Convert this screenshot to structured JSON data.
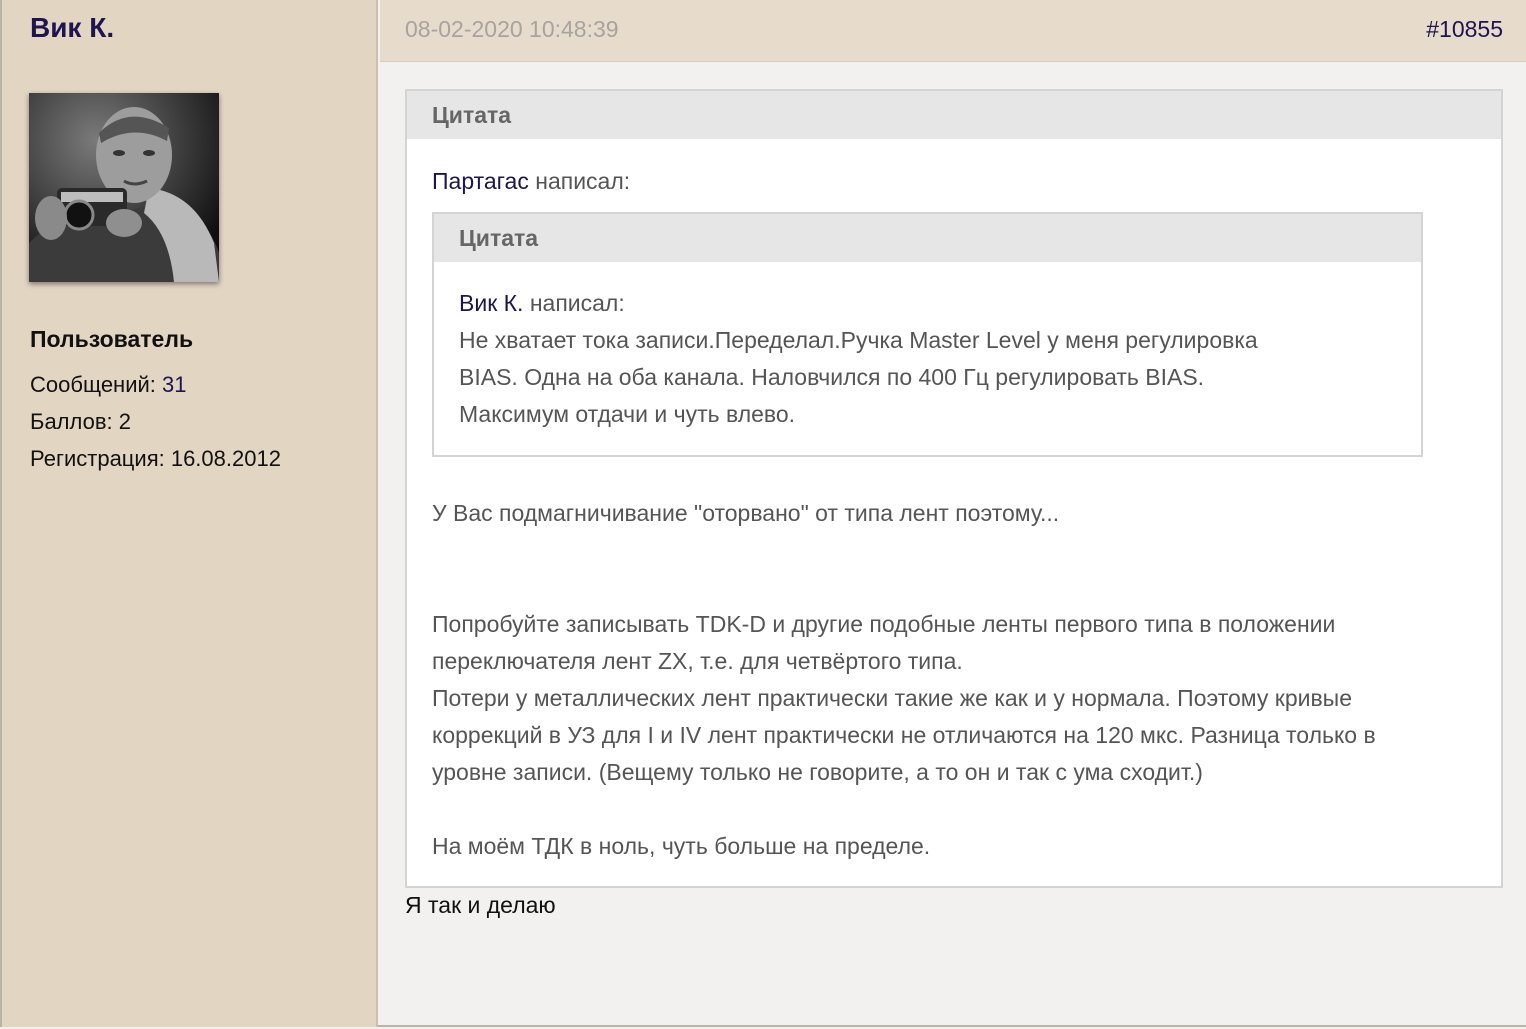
{
  "user": {
    "name": "Вик К.",
    "rank": "Пользователь",
    "messages_label": "Сообщений: ",
    "messages_value": "31",
    "points_label": "Баллов: 2",
    "registration_label": "Регистрация: 16.08.2012"
  },
  "post": {
    "date": "08-02-2020 10:48:39",
    "number": "#10855",
    "reply_text": "Я так и делаю"
  },
  "outer_quote": {
    "title": "Цитата",
    "author": "Партагас",
    "wrote": " написал:",
    "lines": [
      "У Вас подмагничивание \"оторвано\" от типа лент поэтому...",
      "Попробуйте записывать TDK-D и другие подобные ленты первого типа в положении",
      "переключателя лент ZX, т.е. для четвёртого типа.",
      "Потери у металлических лент практически такие же как и у нормала. Поэтому кривые",
      "коррекций в УЗ для I и IV лент практически не отличаются на 120 мкс. Разница только в",
      "уровне записи. (Вещему только не говорите, а то он и так с ума сходит.)",
      "На моём ТДК в ноль, чуть больше на пределе."
    ]
  },
  "inner_quote": {
    "title": "Цитата",
    "author": "Вик К.",
    "wrote": " написал:",
    "lines": [
      "Не хватает тока записи.Переделал.Ручка Master Level у меня регулировка",
      "BIAS. Одна на оба канала. Наловчился по 400 Гц регулировать BIAS.",
      "Максимум отдачи и чуть влево."
    ]
  }
}
